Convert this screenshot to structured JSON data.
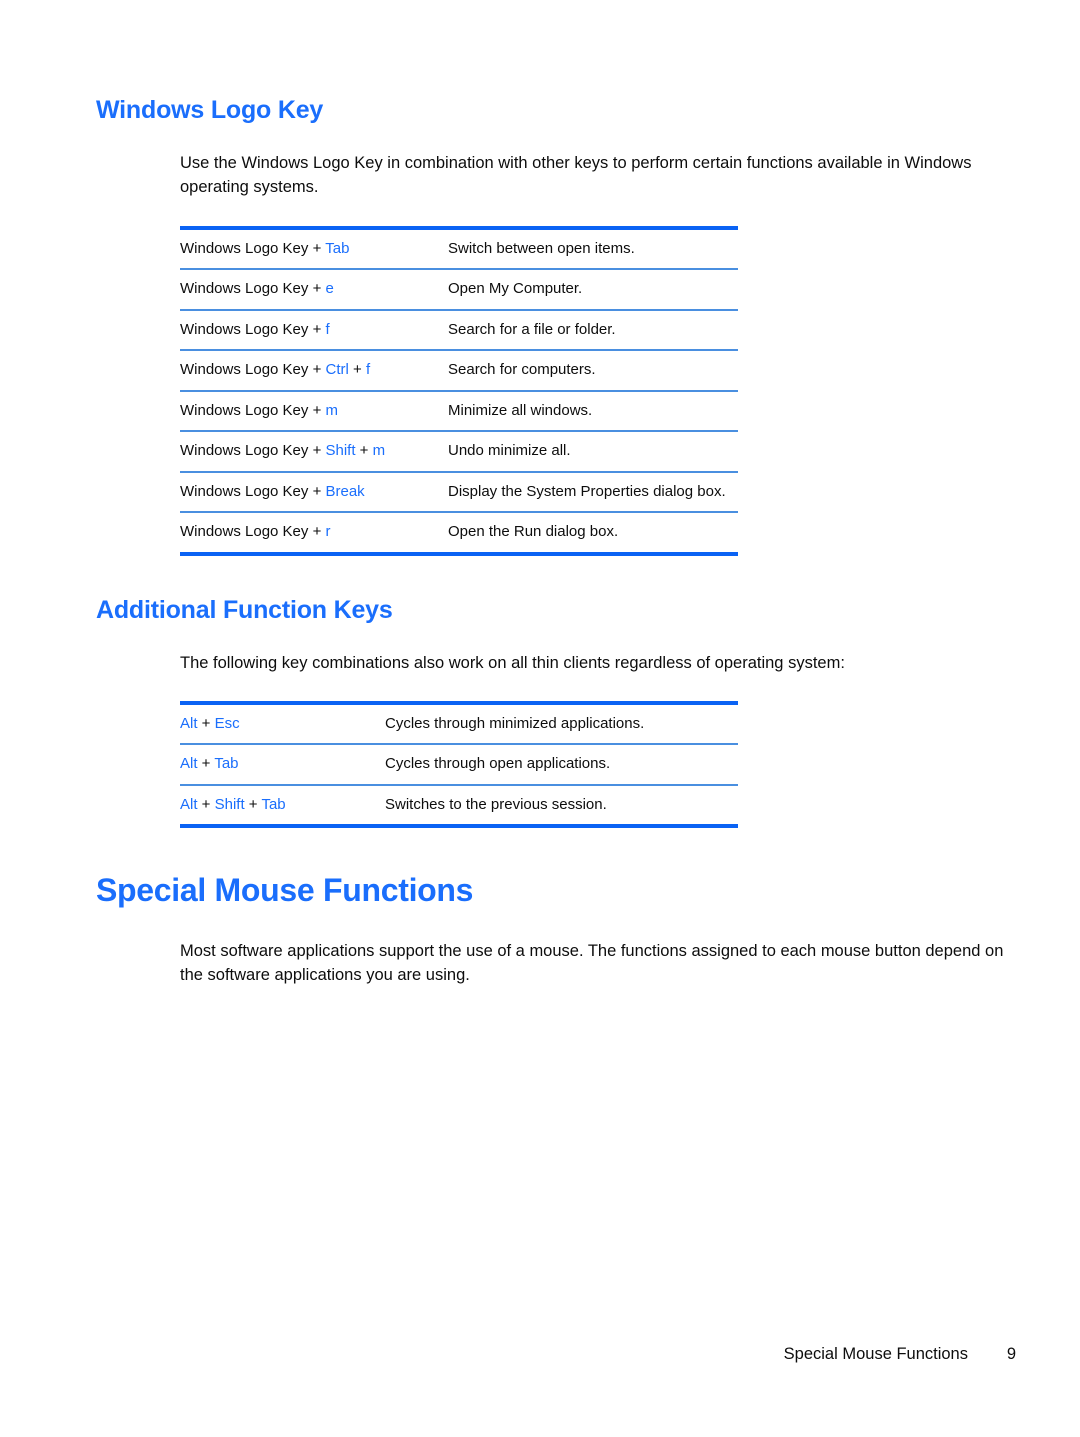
{
  "page": {
    "footer_title": "Special Mouse Functions",
    "footer_page_number": "9"
  },
  "colors": {
    "heading_blue": "#1a6efc",
    "table_border_strong": "#0a63f4",
    "table_border_light": "#4a8fe0",
    "body_text": "#0d0d0d"
  },
  "sections": {
    "windows_logo_key": {
      "heading": "Windows Logo Key",
      "intro": "Use the Windows Logo Key in combination with other keys to perform certain functions available in Windows operating systems.",
      "rows": [
        {
          "combo": [
            {
              "text": "Windows Logo Key + ",
              "style": "plain"
            },
            {
              "text": "Tab",
              "style": "key"
            }
          ],
          "description": "Switch between open items."
        },
        {
          "combo": [
            {
              "text": "Windows Logo Key + ",
              "style": "plain"
            },
            {
              "text": "e",
              "style": "key"
            }
          ],
          "description": "Open My Computer."
        },
        {
          "combo": [
            {
              "text": "Windows Logo Key + ",
              "style": "plain"
            },
            {
              "text": "f",
              "style": "key"
            }
          ],
          "description": "Search for a file or folder."
        },
        {
          "combo": [
            {
              "text": "Windows Logo Key + ",
              "style": "plain"
            },
            {
              "text": "Ctrl",
              "style": "key"
            },
            {
              "text": " + ",
              "style": "plain"
            },
            {
              "text": "f",
              "style": "key"
            }
          ],
          "description": "Search for computers."
        },
        {
          "combo": [
            {
              "text": "Windows Logo Key + ",
              "style": "plain"
            },
            {
              "text": "m",
              "style": "key"
            }
          ],
          "description": "Minimize all windows."
        },
        {
          "combo": [
            {
              "text": "Windows Logo Key + ",
              "style": "plain"
            },
            {
              "text": "Shift",
              "style": "key"
            },
            {
              "text": " + ",
              "style": "plain"
            },
            {
              "text": "m",
              "style": "key"
            }
          ],
          "description": "Undo minimize all."
        },
        {
          "combo": [
            {
              "text": "Windows Logo Key + ",
              "style": "plain"
            },
            {
              "text": "Break",
              "style": "key"
            }
          ],
          "description": "Display the System Properties dialog box."
        },
        {
          "combo": [
            {
              "text": "Windows Logo Key + ",
              "style": "plain"
            },
            {
              "text": "r",
              "style": "key"
            }
          ],
          "description": "Open the Run dialog box."
        }
      ]
    },
    "additional_function_keys": {
      "heading": "Additional Function Keys",
      "intro": "The following key combinations also work on all thin clients regardless of operating system:",
      "rows": [
        {
          "combo": [
            {
              "text": "Alt",
              "style": "key"
            },
            {
              "text": " + ",
              "style": "plain"
            },
            {
              "text": "Esc",
              "style": "key"
            }
          ],
          "description": "Cycles through minimized applications."
        },
        {
          "combo": [
            {
              "text": "Alt",
              "style": "key"
            },
            {
              "text": " + ",
              "style": "plain"
            },
            {
              "text": "Tab",
              "style": "key"
            }
          ],
          "description": "Cycles through open applications."
        },
        {
          "combo": [
            {
              "text": "Alt",
              "style": "key"
            },
            {
              "text": " + ",
              "style": "plain"
            },
            {
              "text": "Shift",
              "style": "key"
            },
            {
              "text": " + ",
              "style": "plain"
            },
            {
              "text": "Tab",
              "style": "key"
            }
          ],
          "description": "Switches to the previous session."
        }
      ]
    },
    "special_mouse_functions": {
      "heading": "Special Mouse Functions",
      "intro": "Most software applications support the use of a mouse. The functions assigned to each mouse button depend on the software applications you are using."
    }
  }
}
